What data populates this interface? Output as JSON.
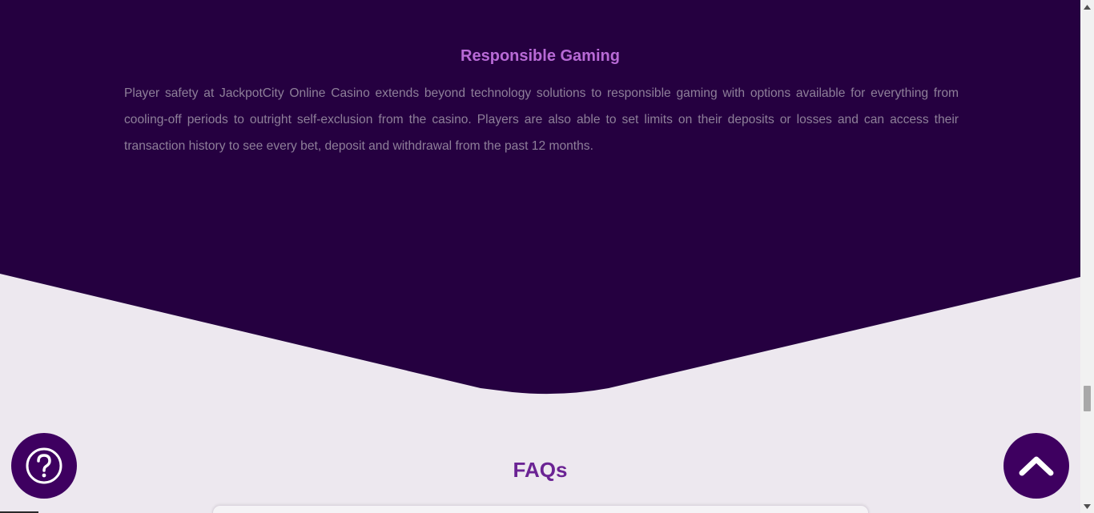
{
  "responsible_gaming": {
    "title": "Responsible Gaming",
    "body": "Player safety at JackpotCity Online Casino extends beyond technology solutions to responsible gaming with options available for everything from cooling-off periods to outright self-exclusion from the casino. Players are also able to set limits on their deposits or losses and can access their transaction history to see every bet, deposit and withdrawal from the past 12 months."
  },
  "faqs": {
    "title": "FAQs"
  },
  "floating_buttons": {
    "help_icon": "question-circle-icon",
    "top_icon": "chevron-up-icon"
  },
  "colors": {
    "dark_section_bg": "#250040",
    "page_bg": "#ede8ef",
    "heading_accent": "#b86ad6",
    "faq_heading": "#6b2394",
    "button_bg": "#3e0060"
  }
}
